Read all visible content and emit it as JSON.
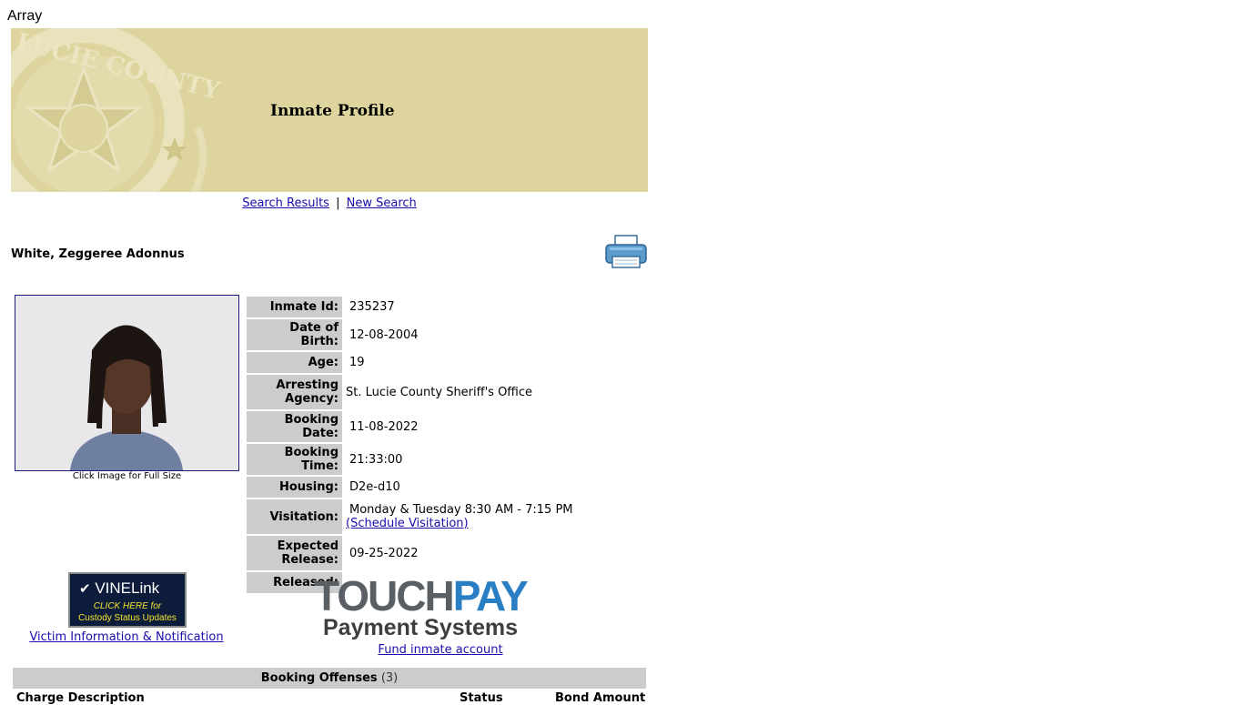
{
  "page": {
    "top_text": "Array"
  },
  "banner": {
    "title": "Inmate Profile",
    "seal_text": "LUCIE COUNTY"
  },
  "nav": {
    "search_results": "Search Results",
    "separator": "|",
    "new_search": "New Search"
  },
  "inmate": {
    "name": "White, Zeggeree Adonnus",
    "photo_caption": "Click Image for Full Size"
  },
  "details": [
    {
      "label": "Inmate Id:",
      "value": "235237"
    },
    {
      "label": "Date of Birth:",
      "value": "12-08-2004"
    },
    {
      "label": "Age:",
      "value": "19"
    },
    {
      "label": "Arresting Agency:",
      "value": "St. Lucie County Sheriff's Office"
    },
    {
      "label": "Booking Date:",
      "value": "11-08-2022"
    },
    {
      "label": "Booking Time:",
      "value": "21:33:00"
    },
    {
      "label": "Housing:",
      "value": "D2e-d10"
    },
    {
      "label": "Visitation:",
      "value": "Monday & Tuesday 8:30 AM - 7:15 PM",
      "link": "(Schedule Visitation)"
    },
    {
      "label": "Expected Release:",
      "value": "09-25-2022"
    },
    {
      "label": "Released:",
      "value": ""
    }
  ],
  "vine": {
    "logo": "VINELink",
    "line1": "CLICK HERE for",
    "line2": "Custody Status Updates",
    "link": "Victim Information & Notification"
  },
  "touchpay": {
    "word1": "TOUCH",
    "word2": "PAY",
    "subtitle": "Payment Systems",
    "link": "Fund inmate account"
  },
  "offenses": {
    "title": "Booking Offenses",
    "count": "(3)",
    "columns": [
      "Charge Description",
      "Status",
      "Bond Amount"
    ]
  },
  "colors": {
    "banner_bg": "#ddd59d",
    "label_bg": "#cccccc",
    "link": "#1a0dab"
  }
}
